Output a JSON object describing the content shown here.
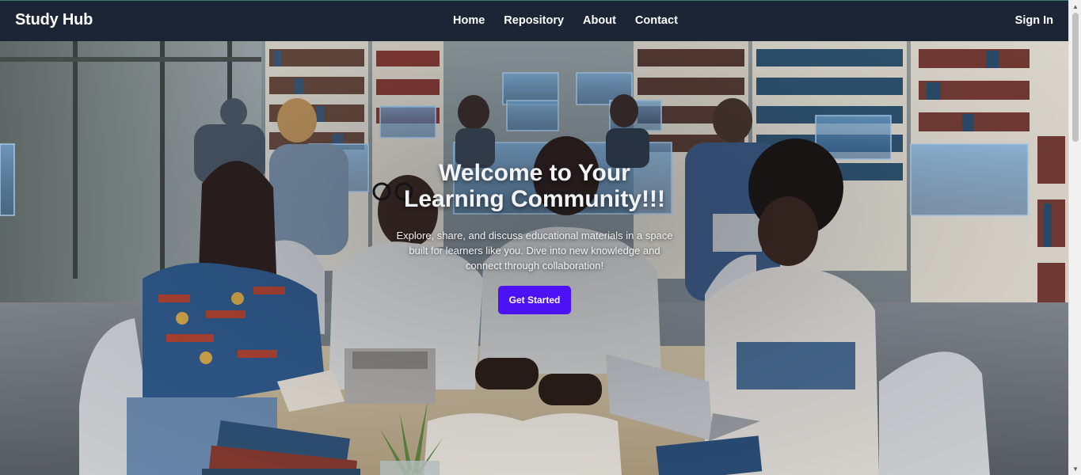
{
  "navbar": {
    "brand": "Study Hub",
    "links": [
      {
        "label": "Home"
      },
      {
        "label": "Repository"
      },
      {
        "label": "About"
      },
      {
        "label": "Contact"
      }
    ],
    "signin": "Sign In"
  },
  "hero": {
    "title_line1": "Welcome to Your",
    "title_line2": "Learning Community!!!",
    "subtitle": "Explore, share, and discuss educational materials in a space built for learners like you. Dive into new knowledge and connect through collaboration!",
    "cta_label": "Get Started"
  },
  "colors": {
    "navbar_bg": "#1b2535",
    "cta_bg": "#4c12f5",
    "text": "#ffffff"
  },
  "scrollbar": {
    "up_icon": "arrow-up-icon",
    "down_icon": "arrow-down-icon"
  }
}
